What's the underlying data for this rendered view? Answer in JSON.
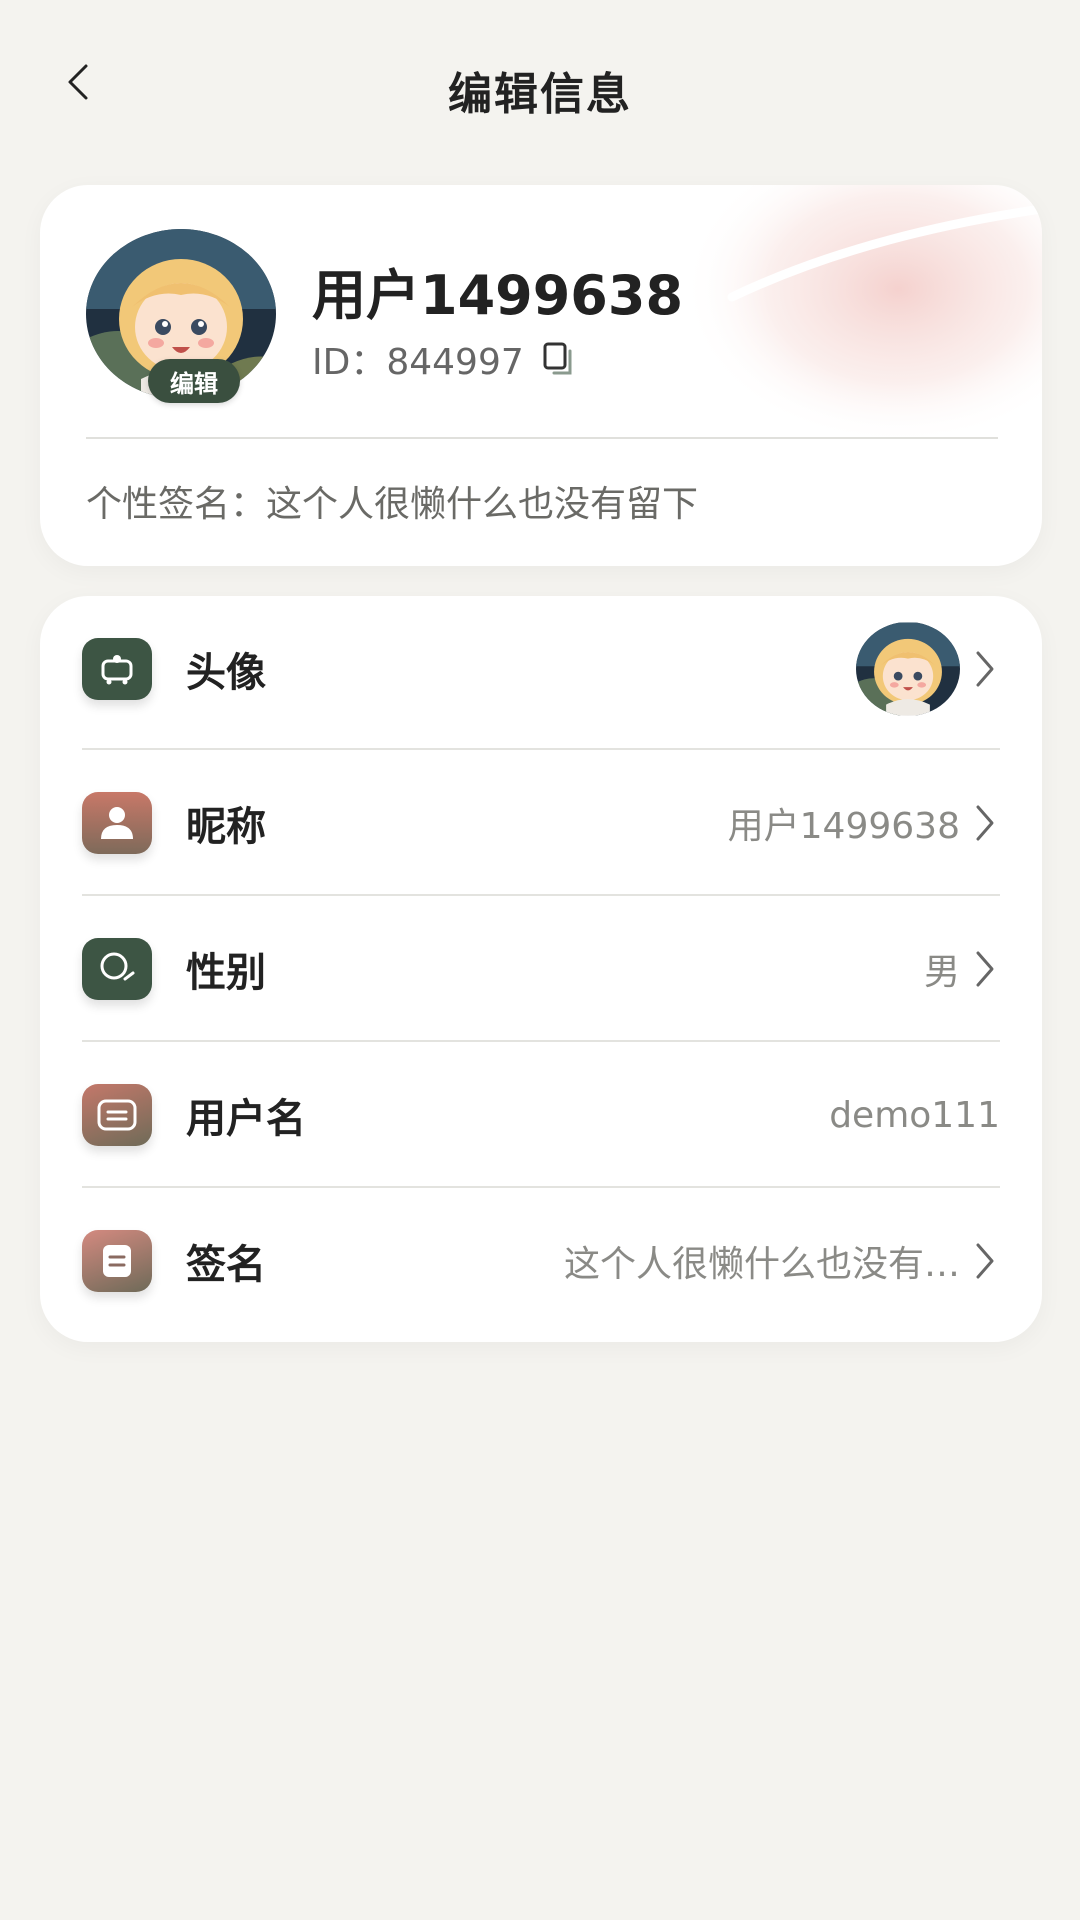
{
  "header": {
    "title": "编辑信息"
  },
  "profile": {
    "name": "用户1499638",
    "id_text": "ID：844997",
    "edit_badge": "编辑",
    "signature_text": "个性签名：这个人很懒什么也没有留下"
  },
  "settings": {
    "rows": [
      {
        "label": "头像",
        "value": "",
        "icon": "avatar-frame-icon",
        "has_chevron": true
      },
      {
        "label": "昵称",
        "value": "用户1499638",
        "icon": "person-icon",
        "has_chevron": true
      },
      {
        "label": "性别",
        "value": "男",
        "icon": "gender-icon",
        "has_chevron": true
      },
      {
        "label": "用户名",
        "value": "demo111",
        "icon": "id-card-icon",
        "has_chevron": false
      },
      {
        "label": "签名",
        "value": "这个人很懒什么也没有…",
        "icon": "note-icon",
        "has_chevron": true
      }
    ]
  },
  "colors": {
    "background": "#f4f3ef",
    "card": "#ffffff",
    "accent_green": "#3d5544",
    "accent_rose": "#c87868"
  }
}
